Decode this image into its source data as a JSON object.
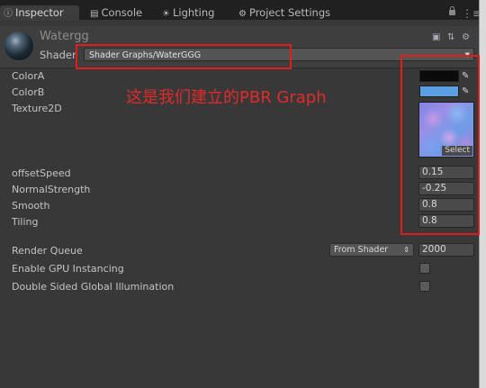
{
  "tabs": [
    {
      "label": "Inspector",
      "icon": "info-icon"
    },
    {
      "label": "Console",
      "icon": "console-icon"
    },
    {
      "label": "Lighting",
      "icon": "lightbulb-icon"
    },
    {
      "label": "Project Settings",
      "icon": "gear-icon"
    }
  ],
  "material": {
    "name": "Watergg",
    "shader_label": "Shader",
    "shader_value": "Shader Graphs/WaterGGG"
  },
  "properties": {
    "color_a": {
      "label": "ColorA",
      "color": "#0a0a0a"
    },
    "color_b": {
      "label": "ColorB",
      "color": "#5b9fe2"
    },
    "texture": {
      "label": "Texture2D",
      "select": "Select"
    },
    "offset_speed": {
      "label": "offsetSpeed",
      "value": "0.15"
    },
    "normal_strength": {
      "label": "NormalStrength",
      "value": "-0.25"
    },
    "smooth": {
      "label": "Smooth",
      "value": "0.8"
    },
    "tiling": {
      "label": "Tiling",
      "value": "0.8"
    }
  },
  "render_queue": {
    "label": "Render Queue",
    "mode": "From Shader",
    "value": "2000"
  },
  "gpu_instancing": {
    "label": "Enable GPU Instancing",
    "checked": false
  },
  "double_sided_gi": {
    "label": "Double Sided Global Illumination",
    "checked": false
  },
  "annotation": "这是我们建立的PBR Graph",
  "accent": {
    "highlight": "#e21b1b"
  }
}
